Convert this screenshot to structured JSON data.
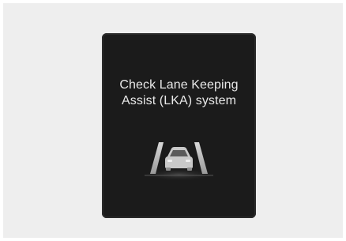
{
  "warning": {
    "line1": "Check Lane Keeping",
    "line2": "Assist (LKA) system",
    "icon": "lane-keeping-assist-icon"
  },
  "colors": {
    "background": "#eeeeee",
    "panel": "#1b1b1b",
    "text": "#e9e9e9",
    "icon": "#cfcfcf"
  }
}
